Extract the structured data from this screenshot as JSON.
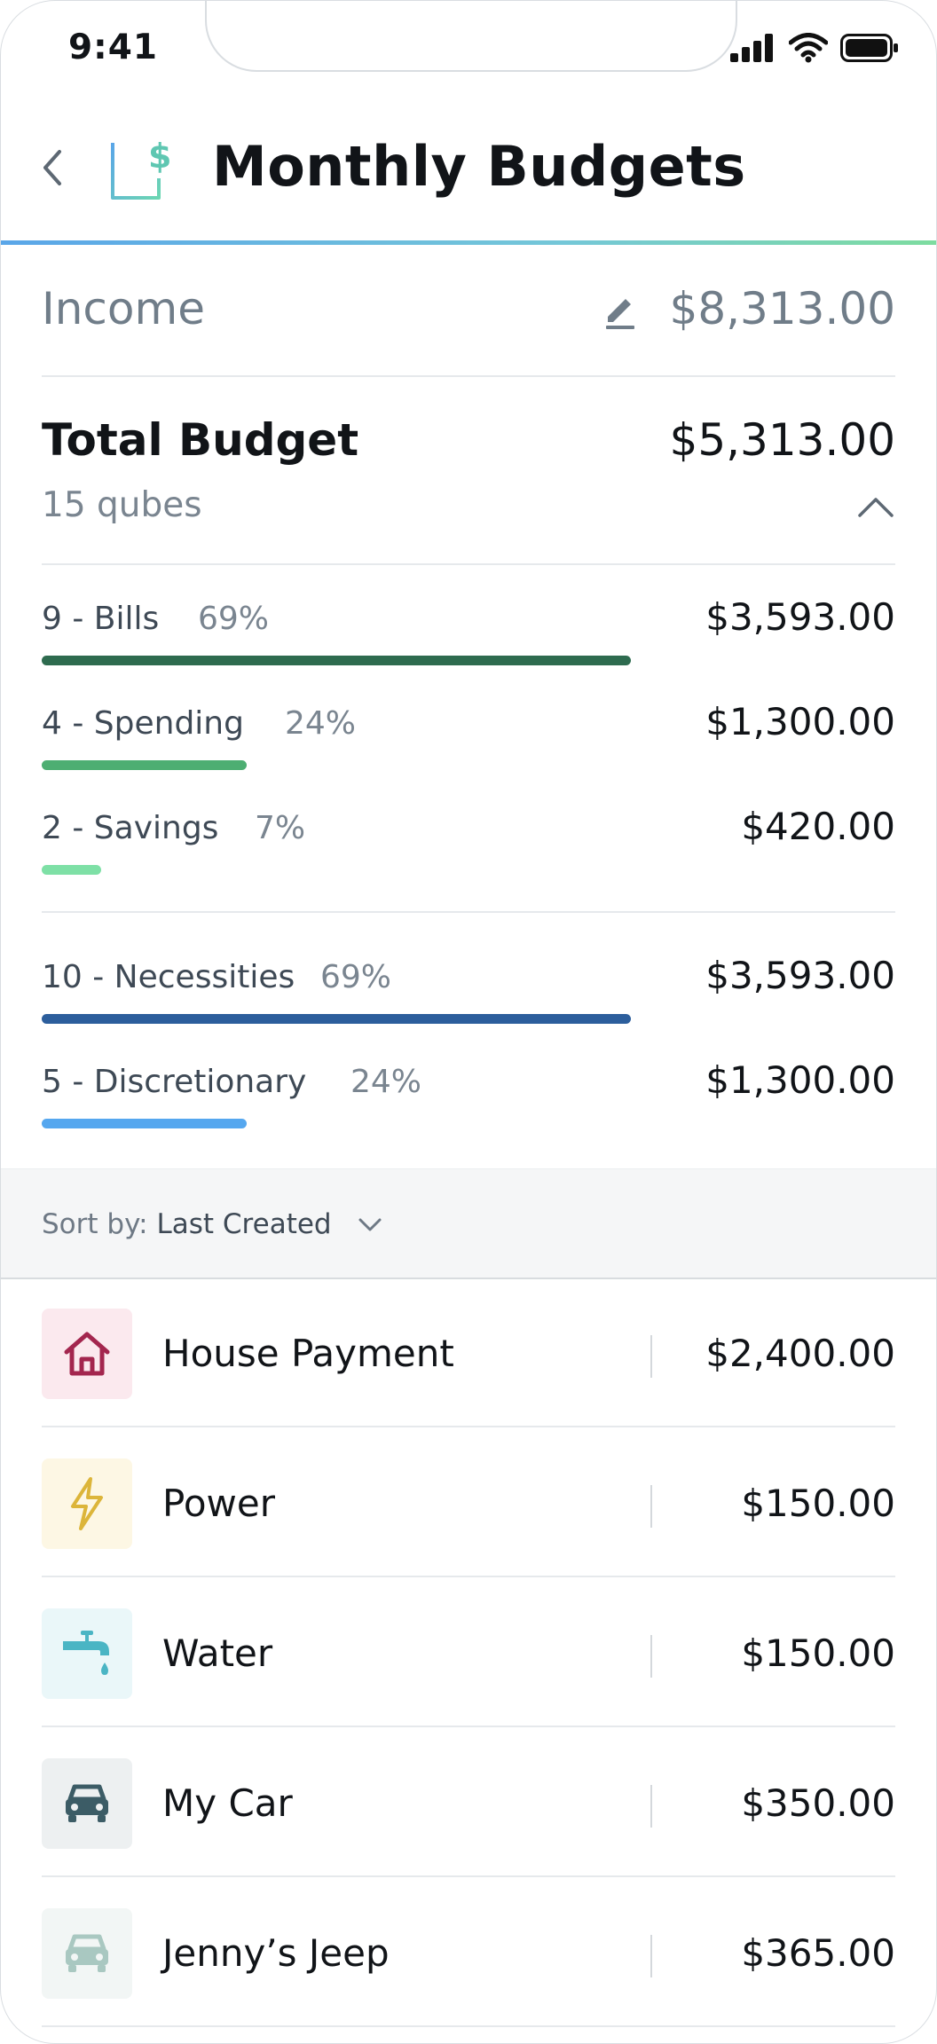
{
  "status_bar": {
    "time": "9:41"
  },
  "header": {
    "title": "Monthly Budgets"
  },
  "income": {
    "label": "Income",
    "amount": "$8,313.00"
  },
  "total_budget": {
    "label": "Total Budget",
    "amount": "$5,313.00",
    "subtitle": "15 qubes"
  },
  "categories": [
    {
      "label": "9 - Bills",
      "percent": "69%",
      "amount": "$3,593.00",
      "fraction": 0.69,
      "color": "#2e6b4f"
    },
    {
      "label": "4 - Spending",
      "percent": "24%",
      "amount": "$1,300.00",
      "fraction": 0.24,
      "color": "#4dae72"
    },
    {
      "label": "2 - Savings",
      "percent": "7%",
      "amount": "$420.00",
      "fraction": 0.07,
      "color": "#7ee0a6"
    }
  ],
  "groups": [
    {
      "label": "10 - Necessities",
      "percent": "69%",
      "amount": "$3,593.00",
      "fraction": 0.69,
      "color": "#2c5e9c"
    },
    {
      "label": "5 - Discretionary",
      "percent": "24%",
      "amount": "$1,300.00",
      "fraction": 0.24,
      "color": "#55a7ef"
    }
  ],
  "sort": {
    "label": "Sort by:",
    "value": "Last Created"
  },
  "items": [
    {
      "name": "House Payment",
      "amount": "$2,400.00",
      "icon": "house-icon",
      "icon_color": "#a3264e",
      "icon_bg": "#fbe9ee"
    },
    {
      "name": "Power",
      "amount": "$150.00",
      "icon": "lightning-icon",
      "icon_color": "#dcb53a",
      "icon_bg": "#fdf7e4"
    },
    {
      "name": "Water",
      "amount": "$150.00",
      "icon": "faucet-icon",
      "icon_color": "#4ab5c4",
      "icon_bg": "#eaf7f9"
    },
    {
      "name": "My Car",
      "amount": "$350.00",
      "icon": "car-icon",
      "icon_color": "#3c5c66",
      "icon_bg": "#edf0f1"
    },
    {
      "name": "Jenny’s Jeep",
      "amount": "$365.00",
      "icon": "car-icon",
      "icon_color": "#a9c8c1",
      "icon_bg": "#f2f6f5"
    }
  ]
}
